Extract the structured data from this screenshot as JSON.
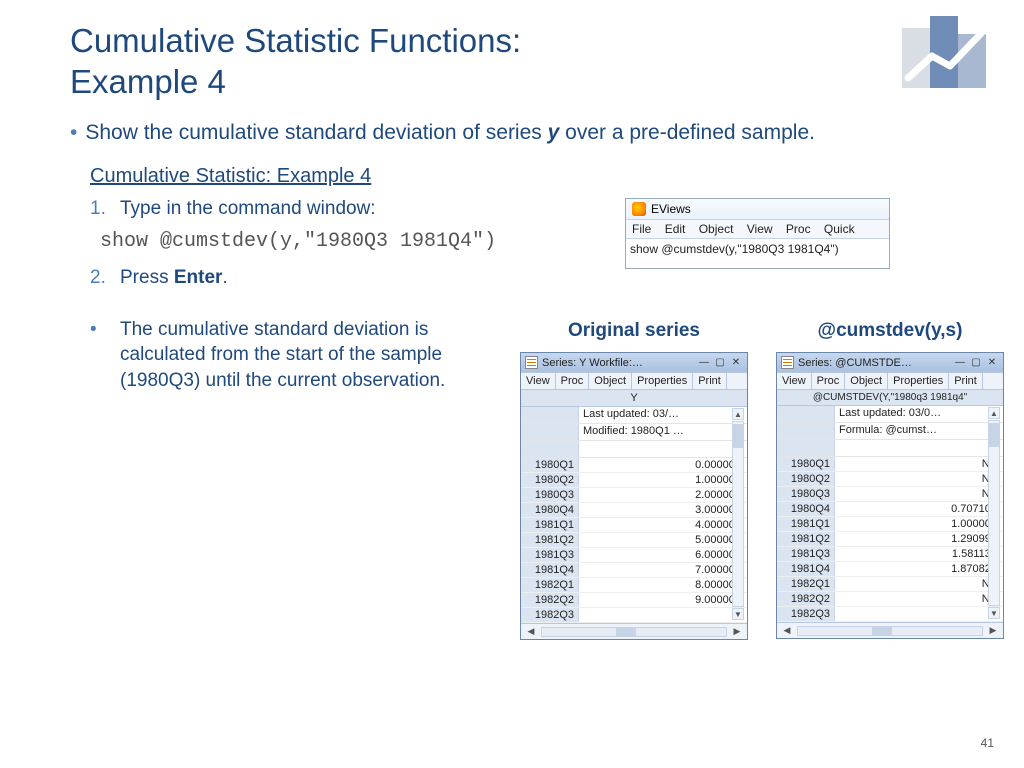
{
  "title_line1": "Cumulative Statistic Functions:",
  "title_line2": "Example 4",
  "main_bullet_a": "Show the cumulative standard deviation of series ",
  "main_bullet_y": "y",
  "main_bullet_b": " over a pre-defined sample.",
  "sub_heading": "Cumulative Statistic: Example 4",
  "steps": {
    "s1_num": "1.",
    "s1_text": "Type in the command window:",
    "code": "show @cumstdev(y,\"1980Q3 1981Q4\")",
    "s2_num": "2.",
    "s2_text_a": "Press ",
    "s2_text_b": "Enter",
    "s2_text_c": "."
  },
  "explain": "The cumulative standard deviation is calculated from the start of the sample (1980Q3) until the current observation.",
  "cmdwin": {
    "app": "EViews",
    "menu": [
      "File",
      "Edit",
      "Object",
      "View",
      "Proc",
      "Quick"
    ],
    "cmd": "show @cumstdev(y,\"1980Q3 1981Q4\")"
  },
  "left_label": "Original series",
  "right_label": "@cumstdev(y,s)",
  "left_win": {
    "title": "Series: Y   Workfile:…",
    "toolbar": [
      "View",
      "Proc",
      "Object",
      "Properties",
      "Print"
    ],
    "header": "Y",
    "meta": [
      "Last updated: 03/…",
      "Modified: 1980Q1 …"
    ],
    "rows": [
      {
        "p": "1980Q1",
        "v": "0.000000"
      },
      {
        "p": "1980Q2",
        "v": "1.000000"
      },
      {
        "p": "1980Q3",
        "v": "2.000000"
      },
      {
        "p": "1980Q4",
        "v": "3.000000"
      },
      {
        "p": "1981Q1",
        "v": "4.000000"
      },
      {
        "p": "1981Q2",
        "v": "5.000000"
      },
      {
        "p": "1981Q3",
        "v": "6.000000"
      },
      {
        "p": "1981Q4",
        "v": "7.000000"
      },
      {
        "p": "1982Q1",
        "v": "8.000000"
      },
      {
        "p": "1982Q2",
        "v": "9.000000"
      },
      {
        "p": "1982Q3",
        "v": ""
      }
    ]
  },
  "right_win": {
    "title": "Series: @CUMSTDE…",
    "toolbar": [
      "View",
      "Proc",
      "Object",
      "Properties",
      "Print"
    ],
    "header": "@CUMSTDEV(Y,\"1980q3 1981q4\"",
    "meta": [
      "Last updated: 03/0…",
      "Formula: @cumst…"
    ],
    "rows": [
      {
        "p": "1980Q1",
        "v": "NA"
      },
      {
        "p": "1980Q2",
        "v": "NA"
      },
      {
        "p": "1980Q3",
        "v": "NA"
      },
      {
        "p": "1980Q4",
        "v": "0.707107"
      },
      {
        "p": "1981Q1",
        "v": "1.000000"
      },
      {
        "p": "1981Q2",
        "v": "1.290994"
      },
      {
        "p": "1981Q3",
        "v": "1.581139"
      },
      {
        "p": "1981Q4",
        "v": "1.870829"
      },
      {
        "p": "1982Q1",
        "v": "NA"
      },
      {
        "p": "1982Q2",
        "v": "NA"
      },
      {
        "p": "1982Q3",
        "v": ""
      }
    ]
  },
  "page_num": "41"
}
